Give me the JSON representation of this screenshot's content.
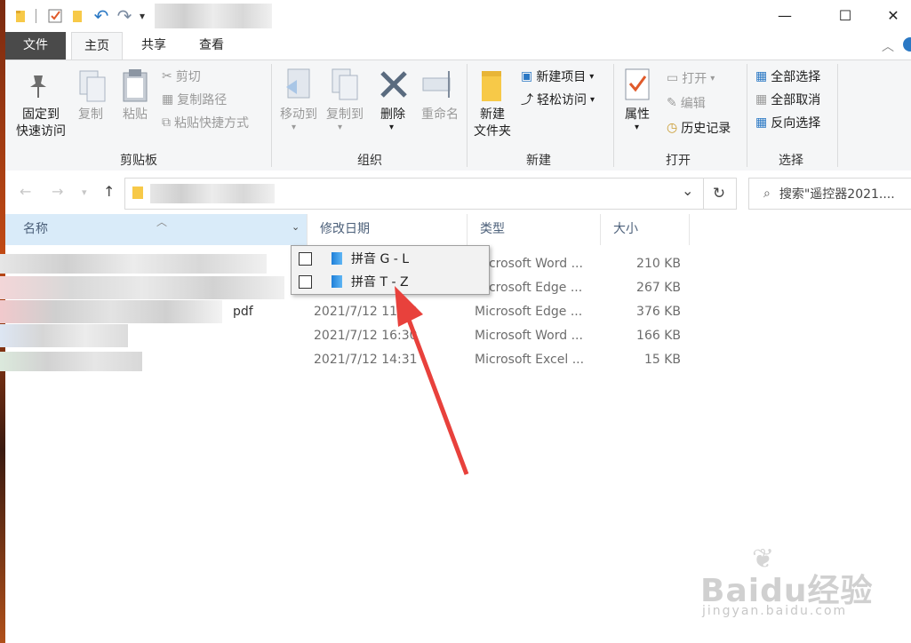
{
  "title_bar": {
    "min_symbol": "—",
    "max_symbol": "☐",
    "close_symbol": "✕",
    "dropdown_symbol": "▾",
    "undo_symbol": "↶",
    "redo_symbol": "↷"
  },
  "tabs": [
    {
      "label": "文件"
    },
    {
      "label": "主页"
    },
    {
      "label": "共享"
    },
    {
      "label": "查看"
    }
  ],
  "ribbon": {
    "clipboard": {
      "pin_label_1": "固定到",
      "pin_label_2": "快速访问",
      "copy_label": "复制",
      "paste_label": "粘贴",
      "cut_label": "剪切",
      "copy_path_label": "复制路径",
      "paste_shortcut_label": "粘贴快捷方式",
      "group_label": "剪贴板"
    },
    "organize": {
      "move_to_label": "移动到",
      "copy_to_label": "复制到",
      "delete_label": "删除",
      "rename_label": "重命名",
      "group_label": "组织"
    },
    "new": {
      "new_folder_label_1": "新建",
      "new_folder_label_2": "文件夹",
      "new_item_label": "新建项目",
      "easy_access_label": "轻松访问",
      "group_label": "新建"
    },
    "open": {
      "properties_label": "属性",
      "open_label": "打开",
      "edit_label": "编辑",
      "history_label": "历史记录",
      "group_label": "打开"
    },
    "select": {
      "select_all_label": "全部选择",
      "select_none_label": "全部取消",
      "invert_label": "反向选择",
      "group_label": "选择"
    }
  },
  "address": {
    "search_placeholder": "搜索\"遥控器2021....",
    "refresh_symbol": "↻",
    "dropdown_symbol": "⌄"
  },
  "columns": {
    "name": "名称",
    "modified": "修改日期",
    "type": "类型",
    "size": "大小"
  },
  "rows": [
    {
      "date": "",
      "type": "Microsoft Word ...",
      "size": "210 KB"
    },
    {
      "date": "",
      "type": "Microsoft Edge ...",
      "size": "267 KB"
    },
    {
      "date": "2021/7/12 11:28",
      "type": "Microsoft Edge ...",
      "size": "376 KB"
    },
    {
      "date": "2021/7/12 16:30",
      "type": "Microsoft Word ...",
      "size": "166 KB"
    },
    {
      "date": "2021/7/12 14:31",
      "type": "Microsoft Excel ...",
      "size": "15 KB"
    }
  ],
  "row3_name_fragment": "pdf",
  "filter_popup": {
    "items": [
      {
        "label": "拼音 G - L"
      },
      {
        "label": "拼音 T - Z"
      }
    ]
  },
  "watermark": {
    "brand": "Baidu经验",
    "url": "jingyan.baidu.com"
  },
  "colors": {
    "file_tab": "#4a4a4a",
    "ribbon_bg": "#f5f6f7",
    "header_selected": "#d9ebf9",
    "arrow": "#e8413c",
    "icon_blue": "#2a78c4"
  }
}
